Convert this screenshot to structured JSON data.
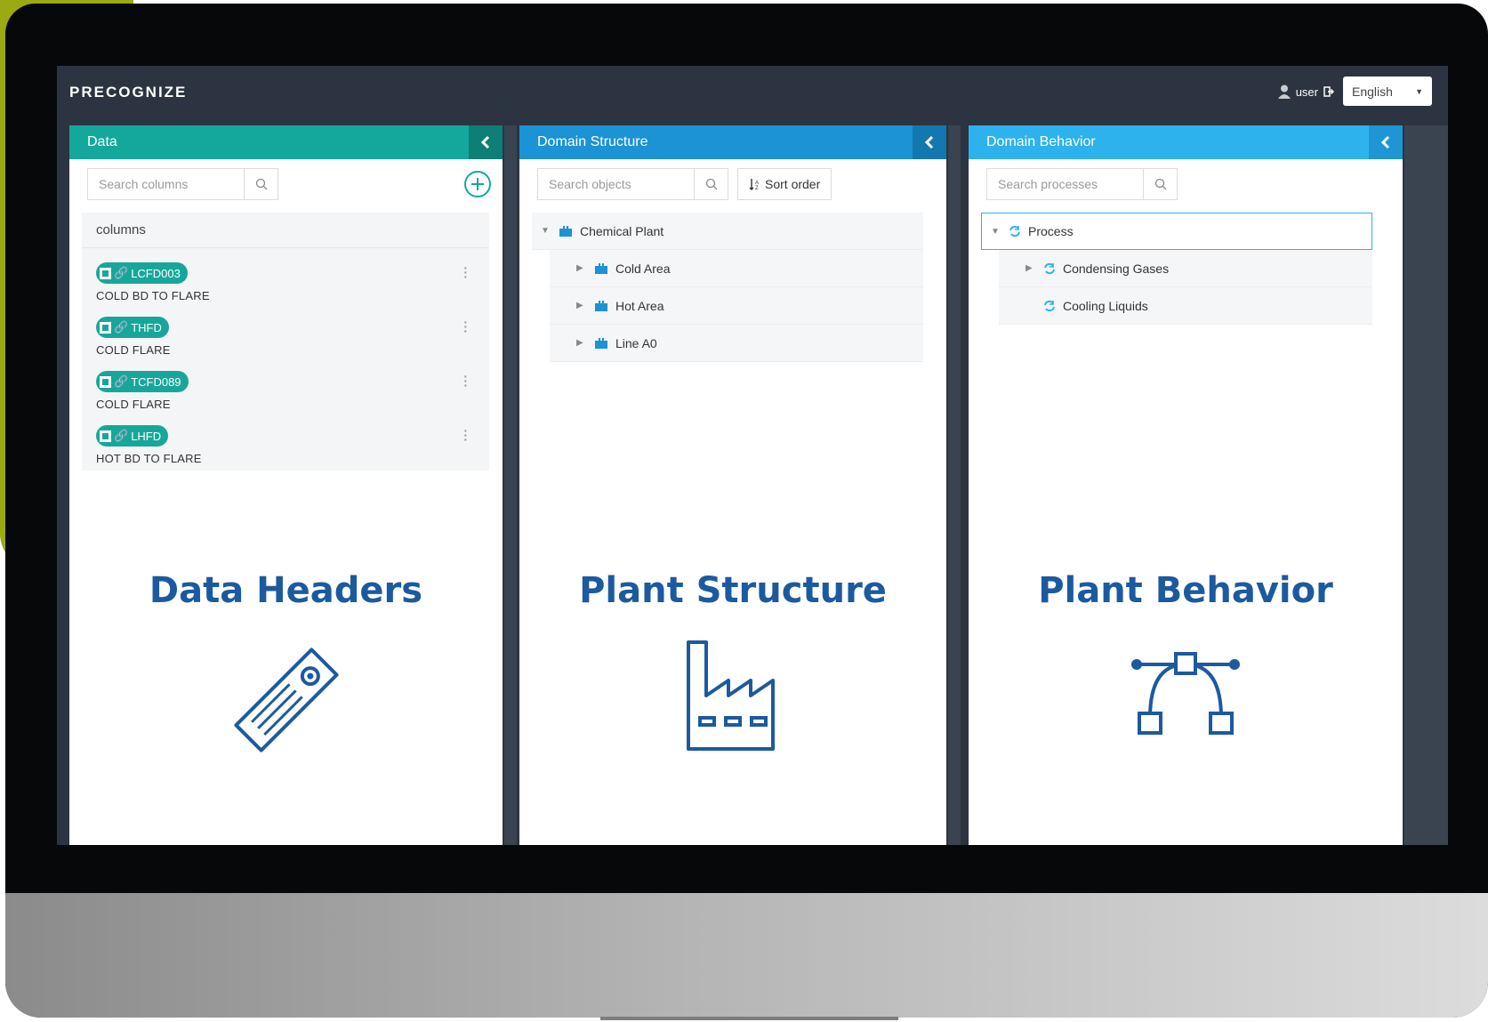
{
  "app": {
    "logo_text": "PRECOGNIZE"
  },
  "topbar": {
    "user_label": "user",
    "language": "English"
  },
  "panels": {
    "data": {
      "title": "Data",
      "search_placeholder": "Search columns",
      "columns_title": "columns",
      "items": [
        {
          "tag": "LCFD003",
          "desc": "COLD BD TO FLARE"
        },
        {
          "tag": "THFD",
          "desc": "COLD FLARE"
        },
        {
          "tag": "TCFD089",
          "desc": "COLD FLARE"
        },
        {
          "tag": "LHFD",
          "desc": "HOT BD TO FLARE"
        }
      ],
      "caption": "Data Headers"
    },
    "structure": {
      "title": "Domain Structure",
      "search_placeholder": "Search objects",
      "sort_label": "Sort order",
      "root": "Chemical Plant",
      "children": [
        "Cold Area",
        "Hot Area",
        "Line A0"
      ],
      "caption": "Plant Structure"
    },
    "behavior": {
      "title": "Domain Behavior",
      "search_placeholder": "Search processes",
      "root": "Process",
      "children": [
        "Condensing Gases",
        "Cooling Liquids"
      ],
      "caption": "Plant Behavior"
    }
  },
  "colors": {
    "accent_green": "#9aaa12",
    "teal": "#13a89b",
    "blue": "#1b93d4",
    "light_blue": "#2db2ee",
    "caption_blue": "#1c5aa0"
  },
  "icons": [
    "user-icon",
    "logout-icon",
    "search-icon",
    "add-icon",
    "link-icon",
    "tree-node-icon",
    "sort-icon",
    "process-icon",
    "tag-icon",
    "factory-icon",
    "bezier-icon"
  ]
}
